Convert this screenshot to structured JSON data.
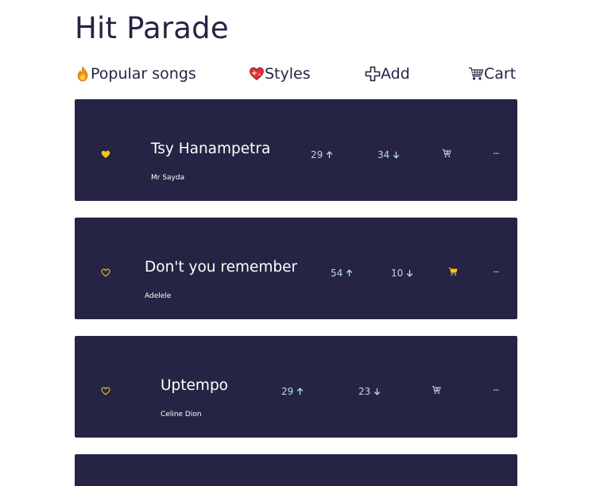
{
  "app": {
    "title": "Hit Parade"
  },
  "nav": [
    {
      "label": "Popular songs",
      "icon": "fire-icon"
    },
    {
      "label": "Styles",
      "icon": "sparkling-heart-icon"
    },
    {
      "label": "Add",
      "icon": "plus-icon"
    },
    {
      "label": "Cart",
      "icon": "shopping-cart-icon"
    }
  ],
  "colors": {
    "card_bg": "#262444",
    "accent_yellow": "#f5c518",
    "vote_text": "#b9d9f2",
    "title_text": "#262444"
  },
  "songs": [
    {
      "title": "Tsy Hanampetra",
      "artist": "Mr Sayda",
      "upvotes": "29",
      "downvotes": "34",
      "favorite": true,
      "in_cart": false
    },
    {
      "title": "Don't you remember",
      "artist": "Adelele",
      "upvotes": "54",
      "downvotes": "10",
      "favorite": false,
      "in_cart": true
    },
    {
      "title": "Uptempo",
      "artist": "Celine Dion",
      "upvotes": "29",
      "downvotes": "23",
      "favorite": false,
      "in_cart": false
    }
  ],
  "more_label": "···"
}
